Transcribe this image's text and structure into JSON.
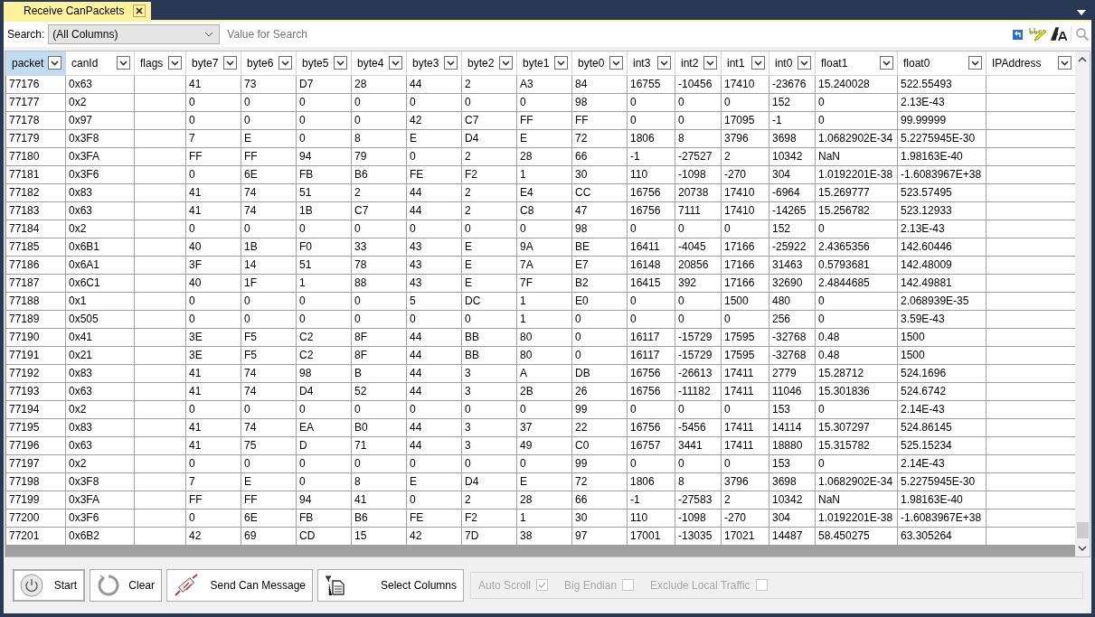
{
  "tab": {
    "title": "Receive CanPackets"
  },
  "search": {
    "label": "Search:",
    "column": "(All Columns)",
    "placeholder": "Value for Search"
  },
  "table": {
    "columns": [
      {
        "label": "packet",
        "selected": true
      },
      {
        "label": "canId",
        "selected": false
      },
      {
        "label": "flags",
        "selected": false
      },
      {
        "label": "byte7",
        "selected": false
      },
      {
        "label": "byte6",
        "selected": false
      },
      {
        "label": "byte5",
        "selected": false
      },
      {
        "label": "byte4",
        "selected": false
      },
      {
        "label": "byte3",
        "selected": false
      },
      {
        "label": "byte2",
        "selected": false
      },
      {
        "label": "byte1",
        "selected": false
      },
      {
        "label": "byte0",
        "selected": false
      },
      {
        "label": "int3",
        "selected": false
      },
      {
        "label": "int2",
        "selected": false
      },
      {
        "label": "int1",
        "selected": false
      },
      {
        "label": "int0",
        "selected": false
      },
      {
        "label": "float1",
        "selected": false
      },
      {
        "label": "float0",
        "selected": false
      },
      {
        "label": "IPAddress",
        "selected": false
      }
    ],
    "rows": [
      [
        "77176",
        "0x63",
        null,
        "41",
        "73",
        "D7",
        "28",
        "44",
        "2",
        "A3",
        "84",
        "16755",
        "-10456",
        "17410",
        "-23676",
        "15.240028",
        "522.55493",
        null
      ],
      [
        "77177",
        "0x2",
        null,
        "0",
        "0",
        "0",
        "0",
        "0",
        "0",
        "0",
        "98",
        "0",
        "0",
        "0",
        "152",
        "0",
        "2.13E-43",
        null
      ],
      [
        "77178",
        "0x97",
        null,
        "0",
        "0",
        "0",
        "0",
        "42",
        "C7",
        "FF",
        "FF",
        "0",
        "0",
        "17095",
        "-1",
        "0",
        "99.99999",
        null
      ],
      [
        "77179",
        "0x3F8",
        null,
        "7",
        "E",
        "0",
        "8",
        "E",
        "D4",
        "E",
        "72",
        "1806",
        "8",
        "3796",
        "3698",
        "1.0682902E-34",
        "5.2275945E-30",
        null
      ],
      [
        "77180",
        "0x3FA",
        null,
        "FF",
        "FF",
        "94",
        "79",
        "0",
        "2",
        "28",
        "66",
        "-1",
        "-27527",
        "2",
        "10342",
        "NaN",
        "1.98163E-40",
        null
      ],
      [
        "77181",
        "0x3F6",
        null,
        "0",
        "6E",
        "FB",
        "B6",
        "FE",
        "F2",
        "1",
        "30",
        "110",
        "-1098",
        "-270",
        "304",
        "1.0192201E-38",
        "-1.6083967E+38",
        null
      ],
      [
        "77182",
        "0x83",
        null,
        "41",
        "74",
        "51",
        "2",
        "44",
        "2",
        "E4",
        "CC",
        "16756",
        "20738",
        "17410",
        "-6964",
        "15.269777",
        "523.57495",
        null
      ],
      [
        "77183",
        "0x63",
        null,
        "41",
        "74",
        "1B",
        "C7",
        "44",
        "2",
        "C8",
        "47",
        "16756",
        "7111",
        "17410",
        "-14265",
        "15.256782",
        "523.12933",
        null
      ],
      [
        "77184",
        "0x2",
        null,
        "0",
        "0",
        "0",
        "0",
        "0",
        "0",
        "0",
        "98",
        "0",
        "0",
        "0",
        "152",
        "0",
        "2.13E-43",
        null
      ],
      [
        "77185",
        "0x6B1",
        null,
        "40",
        "1B",
        "F0",
        "33",
        "43",
        "E",
        "9A",
        "BE",
        "16411",
        "-4045",
        "17166",
        "-25922",
        "2.4365356",
        "142.60446",
        null
      ],
      [
        "77186",
        "0x6A1",
        null,
        "3F",
        "14",
        "51",
        "78",
        "43",
        "E",
        "7A",
        "E7",
        "16148",
        "20856",
        "17166",
        "31463",
        "0.5793681",
        "142.48009",
        null
      ],
      [
        "77187",
        "0x6C1",
        null,
        "40",
        "1F",
        "1",
        "88",
        "43",
        "E",
        "7F",
        "B2",
        "16415",
        "392",
        "17166",
        "32690",
        "2.4844685",
        "142.49881",
        null
      ],
      [
        "77188",
        "0x1",
        null,
        "0",
        "0",
        "0",
        "0",
        "5",
        "DC",
        "1",
        "E0",
        "0",
        "0",
        "1500",
        "480",
        "0",
        "2.068939E-35",
        null
      ],
      [
        "77189",
        "0x505",
        null,
        "0",
        "0",
        "0",
        "0",
        "0",
        "0",
        "1",
        "0",
        "0",
        "0",
        "0",
        "256",
        "0",
        "3.59E-43",
        null
      ],
      [
        "77190",
        "0x41",
        null,
        "3E",
        "F5",
        "C2",
        "8F",
        "44",
        "BB",
        "80",
        "0",
        "16117",
        "-15729",
        "17595",
        "-32768",
        "0.48",
        "1500",
        null
      ],
      [
        "77191",
        "0x21",
        null,
        "3E",
        "F5",
        "C2",
        "8F",
        "44",
        "BB",
        "80",
        "0",
        "16117",
        "-15729",
        "17595",
        "-32768",
        "0.48",
        "1500",
        null
      ],
      [
        "77192",
        "0x83",
        null,
        "41",
        "74",
        "98",
        "B",
        "44",
        "3",
        "A",
        "DB",
        "16756",
        "-26613",
        "17411",
        "2779",
        "15.28712",
        "524.1696",
        null
      ],
      [
        "77193",
        "0x63",
        null,
        "41",
        "74",
        "D4",
        "52",
        "44",
        "3",
        "2B",
        "26",
        "16756",
        "-11182",
        "17411",
        "11046",
        "15.301836",
        "524.6742",
        null
      ],
      [
        "77194",
        "0x2",
        null,
        "0",
        "0",
        "0",
        "0",
        "0",
        "0",
        "0",
        "99",
        "0",
        "0",
        "0",
        "153",
        "0",
        "2.14E-43",
        null
      ],
      [
        "77195",
        "0x83",
        null,
        "41",
        "74",
        "EA",
        "B0",
        "44",
        "3",
        "37",
        "22",
        "16756",
        "-5456",
        "17411",
        "14114",
        "15.307297",
        "524.86145",
        null
      ],
      [
        "77196",
        "0x63",
        null,
        "41",
        "75",
        "D",
        "71",
        "44",
        "3",
        "49",
        "C0",
        "16757",
        "3441",
        "17411",
        "18880",
        "15.315782",
        "525.15234",
        null
      ],
      [
        "77197",
        "0x2",
        null,
        "0",
        "0",
        "0",
        "0",
        "0",
        "0",
        "0",
        "99",
        "0",
        "0",
        "0",
        "153",
        "0",
        "2.14E-43",
        null
      ],
      [
        "77198",
        "0x3F8",
        null,
        "7",
        "E",
        "0",
        "8",
        "E",
        "D4",
        "E",
        "72",
        "1806",
        "8",
        "3796",
        "3698",
        "1.0682902E-34",
        "5.2275945E-30",
        null
      ],
      [
        "77199",
        "0x3FA",
        null,
        "FF",
        "FF",
        "94",
        "41",
        "0",
        "2",
        "28",
        "66",
        "-1",
        "-27583",
        "2",
        "10342",
        "NaN",
        "1.98163E-40",
        null
      ],
      [
        "77200",
        "0x3F6",
        null,
        "0",
        "6E",
        "FB",
        "B6",
        "FE",
        "F2",
        "1",
        "30",
        "110",
        "-1098",
        "-270",
        "304",
        "1.0192201E-38",
        "-1.6083967E+38",
        null
      ],
      [
        "77201",
        "0x6B2",
        null,
        "42",
        "69",
        "CD",
        "15",
        "42",
        "7D",
        "38",
        "97",
        "17001",
        "-13035",
        "17021",
        "14487",
        "58.450275",
        "63.305264",
        null
      ]
    ]
  },
  "buttons": [
    {
      "label": "Start",
      "kind": "power"
    },
    {
      "label": "Clear",
      "kind": "refresh"
    },
    {
      "label": "Send Can Message",
      "kind": "cable"
    },
    {
      "label": "Select Columns",
      "kind": "columns"
    }
  ],
  "options": [
    {
      "label": "Auto Scroll",
      "checked": true,
      "disabled": true
    },
    {
      "label": "Big Endian",
      "checked": false,
      "disabled": true
    },
    {
      "label": "Exclude Local Traffic",
      "checked": false,
      "disabled": true
    }
  ]
}
